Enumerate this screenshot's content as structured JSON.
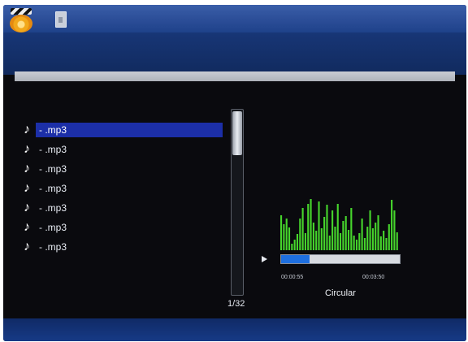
{
  "header": {
    "app_icon": "clapperboard-icon",
    "storage_icon": "sd-card-icon"
  },
  "file_list": {
    "items": [
      {
        "label": "- .mp3",
        "icon": "music-note-icon",
        "selected": true
      },
      {
        "label": "- .mp3",
        "icon": "music-note-icon",
        "selected": false
      },
      {
        "label": "- .mp3",
        "icon": "music-note-icon",
        "selected": false
      },
      {
        "label": "- .mp3",
        "icon": "music-note-icon",
        "selected": false
      },
      {
        "label": "- .mp3",
        "icon": "music-note-icon",
        "selected": false
      },
      {
        "label": "- .mp3",
        "icon": "music-note-icon",
        "selected": false
      },
      {
        "label": "- .mp3",
        "icon": "music-note-icon",
        "selected": false
      }
    ],
    "page": "1/32"
  },
  "player": {
    "spectrum_levels": [
      0.62,
      0.45,
      0.55,
      0.4,
      0.12,
      0.18,
      0.28,
      0.55,
      0.74,
      0.3,
      0.82,
      0.9,
      0.48,
      0.34,
      0.85,
      0.38,
      0.58,
      0.8,
      0.26,
      0.7,
      0.42,
      0.82,
      0.3,
      0.52,
      0.6,
      0.36,
      0.74,
      0.26,
      0.18,
      0.3,
      0.55,
      0.22,
      0.42,
      0.7,
      0.38,
      0.48,
      0.62,
      0.24,
      0.34,
      0.22,
      0.46,
      0.88,
      0.7,
      0.32
    ],
    "spectrum_color": "#46d52c",
    "progress": 0.24,
    "progress_color": "#1e6fe0",
    "elapsed": "00:00:55",
    "total": "00:03:50",
    "play_mode": "Circular",
    "play_icon": "play-icon"
  }
}
